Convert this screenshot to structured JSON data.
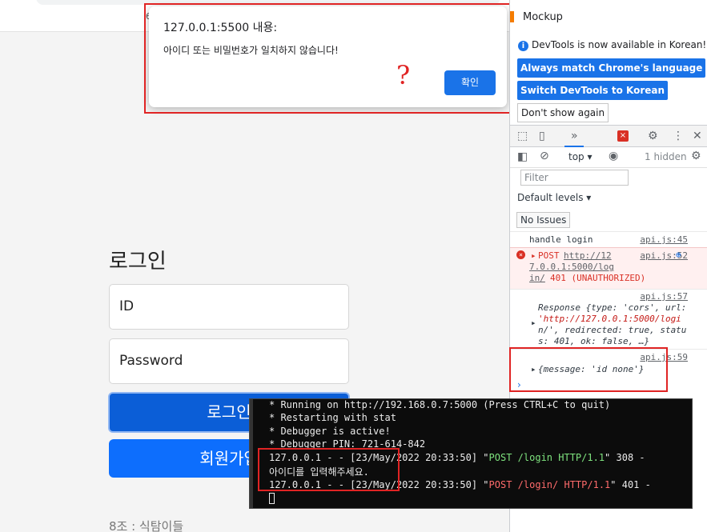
{
  "browser": {
    "tab_fragment": "6"
  },
  "page": {
    "login_title": "로그인",
    "id_placeholder": "ID",
    "password_placeholder": "Password",
    "login_button": "로그인",
    "signup_button": "회원가입",
    "footer": "8조 : 식탐이들"
  },
  "alert": {
    "title": "127.0.0.1:5500 내용:",
    "message": "아이디 또는 비밀번호가 일치하지 않습니다!",
    "ok_label": "확인",
    "annotation": "?"
  },
  "devtools": {
    "device_label": "Mockup",
    "info_text": "DevTools is now available in Korean!",
    "match_language_button": "Always match Chrome's language",
    "switch_korean_button": "Switch DevTools to Korean",
    "dont_show_button": "Don't show again",
    "tab_more": "»",
    "context": "top",
    "hidden_count": "1 hidden",
    "filter_placeholder": "Filter",
    "default_levels": "Default levels ▾",
    "no_issues": "No Issues",
    "console": [
      {
        "text": "handle login",
        "source": "api.js:45"
      },
      {
        "method": "POST",
        "url": "http://127.0.0.1:5000/login/",
        "url_lines": [
          "http://12",
          "7.0.0.1:5000/log",
          "in/"
        ],
        "status": "401 (UNAUTHORIZED)",
        "source": "api.js:52"
      },
      {
        "source": "api.js:57",
        "lines": [
          "Response {type: 'cors', url:",
          "'http://127.0.0.1:5000/logi",
          "n/', redirected: true, statu",
          "s: 401, ok: false, …}"
        ]
      },
      {
        "source": "api.js:59",
        "text": "{message: 'id none'}"
      }
    ]
  },
  "terminal": {
    "lines": [
      " * Running on http://192.168.0.7:5000 (Press CTRL+C to quit)",
      " * Restarting with stat",
      " * Debugger is active!",
      " * Debugger PIN: 721-614-842"
    ],
    "log1_prefix": "127.0.0.1 - - [23/May/2022 20:33:50] \"",
    "log1_request": "POST /login HTTP/1.1",
    "log1_suffix": "\" 308 -",
    "korean_line": "아이디를 입력해주세요.",
    "log2_prefix": "127.0.0.1 - - [23/May/2022 20:33:50] \"",
    "log2_request": "POST /login/ HTTP/1.1",
    "log2_suffix": "\" 401 -"
  }
}
